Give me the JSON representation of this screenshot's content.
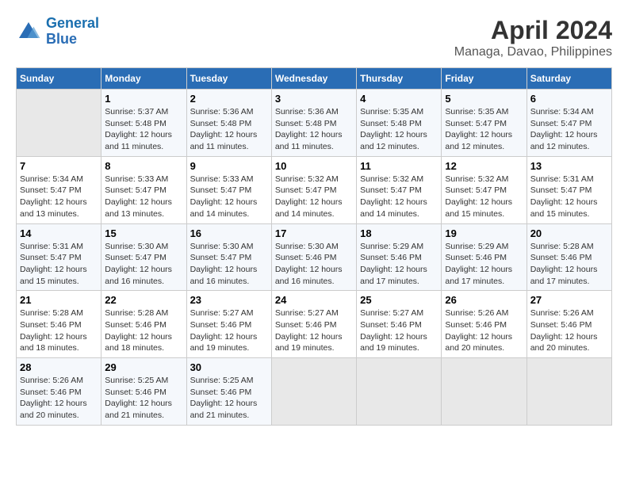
{
  "header": {
    "logo_line1": "General",
    "logo_line2": "Blue",
    "title": "April 2024",
    "subtitle": "Managa, Davao, Philippines"
  },
  "calendar": {
    "days_of_week": [
      "Sunday",
      "Monday",
      "Tuesday",
      "Wednesday",
      "Thursday",
      "Friday",
      "Saturday"
    ],
    "weeks": [
      [
        {
          "num": "",
          "info": ""
        },
        {
          "num": "1",
          "info": "Sunrise: 5:37 AM\nSunset: 5:48 PM\nDaylight: 12 hours\nand 11 minutes."
        },
        {
          "num": "2",
          "info": "Sunrise: 5:36 AM\nSunset: 5:48 PM\nDaylight: 12 hours\nand 11 minutes."
        },
        {
          "num": "3",
          "info": "Sunrise: 5:36 AM\nSunset: 5:48 PM\nDaylight: 12 hours\nand 11 minutes."
        },
        {
          "num": "4",
          "info": "Sunrise: 5:35 AM\nSunset: 5:48 PM\nDaylight: 12 hours\nand 12 minutes."
        },
        {
          "num": "5",
          "info": "Sunrise: 5:35 AM\nSunset: 5:47 PM\nDaylight: 12 hours\nand 12 minutes."
        },
        {
          "num": "6",
          "info": "Sunrise: 5:34 AM\nSunset: 5:47 PM\nDaylight: 12 hours\nand 12 minutes."
        }
      ],
      [
        {
          "num": "7",
          "info": "Sunrise: 5:34 AM\nSunset: 5:47 PM\nDaylight: 12 hours\nand 13 minutes."
        },
        {
          "num": "8",
          "info": "Sunrise: 5:33 AM\nSunset: 5:47 PM\nDaylight: 12 hours\nand 13 minutes."
        },
        {
          "num": "9",
          "info": "Sunrise: 5:33 AM\nSunset: 5:47 PM\nDaylight: 12 hours\nand 14 minutes."
        },
        {
          "num": "10",
          "info": "Sunrise: 5:32 AM\nSunset: 5:47 PM\nDaylight: 12 hours\nand 14 minutes."
        },
        {
          "num": "11",
          "info": "Sunrise: 5:32 AM\nSunset: 5:47 PM\nDaylight: 12 hours\nand 14 minutes."
        },
        {
          "num": "12",
          "info": "Sunrise: 5:32 AM\nSunset: 5:47 PM\nDaylight: 12 hours\nand 15 minutes."
        },
        {
          "num": "13",
          "info": "Sunrise: 5:31 AM\nSunset: 5:47 PM\nDaylight: 12 hours\nand 15 minutes."
        }
      ],
      [
        {
          "num": "14",
          "info": "Sunrise: 5:31 AM\nSunset: 5:47 PM\nDaylight: 12 hours\nand 15 minutes."
        },
        {
          "num": "15",
          "info": "Sunrise: 5:30 AM\nSunset: 5:47 PM\nDaylight: 12 hours\nand 16 minutes."
        },
        {
          "num": "16",
          "info": "Sunrise: 5:30 AM\nSunset: 5:47 PM\nDaylight: 12 hours\nand 16 minutes."
        },
        {
          "num": "17",
          "info": "Sunrise: 5:30 AM\nSunset: 5:46 PM\nDaylight: 12 hours\nand 16 minutes."
        },
        {
          "num": "18",
          "info": "Sunrise: 5:29 AM\nSunset: 5:46 PM\nDaylight: 12 hours\nand 17 minutes."
        },
        {
          "num": "19",
          "info": "Sunrise: 5:29 AM\nSunset: 5:46 PM\nDaylight: 12 hours\nand 17 minutes."
        },
        {
          "num": "20",
          "info": "Sunrise: 5:28 AM\nSunset: 5:46 PM\nDaylight: 12 hours\nand 17 minutes."
        }
      ],
      [
        {
          "num": "21",
          "info": "Sunrise: 5:28 AM\nSunset: 5:46 PM\nDaylight: 12 hours\nand 18 minutes."
        },
        {
          "num": "22",
          "info": "Sunrise: 5:28 AM\nSunset: 5:46 PM\nDaylight: 12 hours\nand 18 minutes."
        },
        {
          "num": "23",
          "info": "Sunrise: 5:27 AM\nSunset: 5:46 PM\nDaylight: 12 hours\nand 19 minutes."
        },
        {
          "num": "24",
          "info": "Sunrise: 5:27 AM\nSunset: 5:46 PM\nDaylight: 12 hours\nand 19 minutes."
        },
        {
          "num": "25",
          "info": "Sunrise: 5:27 AM\nSunset: 5:46 PM\nDaylight: 12 hours\nand 19 minutes."
        },
        {
          "num": "26",
          "info": "Sunrise: 5:26 AM\nSunset: 5:46 PM\nDaylight: 12 hours\nand 20 minutes."
        },
        {
          "num": "27",
          "info": "Sunrise: 5:26 AM\nSunset: 5:46 PM\nDaylight: 12 hours\nand 20 minutes."
        }
      ],
      [
        {
          "num": "28",
          "info": "Sunrise: 5:26 AM\nSunset: 5:46 PM\nDaylight: 12 hours\nand 20 minutes."
        },
        {
          "num": "29",
          "info": "Sunrise: 5:25 AM\nSunset: 5:46 PM\nDaylight: 12 hours\nand 21 minutes."
        },
        {
          "num": "30",
          "info": "Sunrise: 5:25 AM\nSunset: 5:46 PM\nDaylight: 12 hours\nand 21 minutes."
        },
        {
          "num": "",
          "info": ""
        },
        {
          "num": "",
          "info": ""
        },
        {
          "num": "",
          "info": ""
        },
        {
          "num": "",
          "info": ""
        }
      ]
    ]
  }
}
